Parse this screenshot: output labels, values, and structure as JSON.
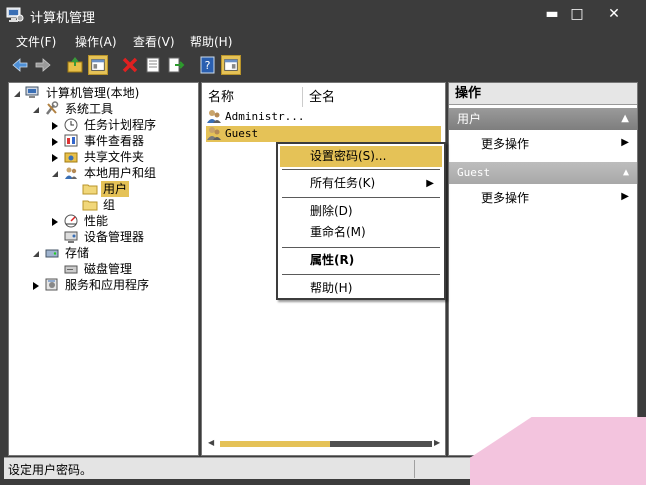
{
  "window": {
    "title": "计算机管理",
    "controls": {
      "minimize": "▬",
      "maximize": "□",
      "close": "✕"
    }
  },
  "menubar": {
    "items": [
      {
        "label": "文件(F)"
      },
      {
        "label": "操作(A)"
      },
      {
        "label": "查看(V)"
      },
      {
        "label": "帮助(H)"
      }
    ]
  },
  "toolbar": {
    "icons": [
      "back-icon",
      "forward-icon",
      "up-folder-icon",
      "show-tree-icon",
      "delete-icon",
      "properties-icon",
      "export-icon",
      "help-icon",
      "action-pane-icon"
    ]
  },
  "tree": {
    "items": [
      {
        "label": "计算机管理(本地)",
        "level": 0,
        "twisty": "open",
        "icon": "computer-icon"
      },
      {
        "label": "系统工具",
        "level": 1,
        "twisty": "open",
        "icon": "tools-icon"
      },
      {
        "label": "任务计划程序",
        "level": 2,
        "twisty": "closed",
        "icon": "clock-icon"
      },
      {
        "label": "事件查看器",
        "level": 2,
        "twisty": "closed",
        "icon": "event-viewer-icon"
      },
      {
        "label": "共享文件夹",
        "level": 2,
        "twisty": "closed",
        "icon": "shared-folder-icon"
      },
      {
        "label": "本地用户和组",
        "level": 2,
        "twisty": "open",
        "icon": "users-icon"
      },
      {
        "label": "用户",
        "level": 3,
        "twisty": "none",
        "icon": "folder-icon",
        "selected": true
      },
      {
        "label": "组",
        "level": 3,
        "twisty": "none",
        "icon": "folder-icon"
      },
      {
        "label": "性能",
        "level": 2,
        "twisty": "closed",
        "icon": "performance-icon"
      },
      {
        "label": "设备管理器",
        "level": 2,
        "twisty": "none",
        "icon": "device-manager-icon"
      },
      {
        "label": "存储",
        "level": 1,
        "twisty": "open",
        "icon": "storage-icon"
      },
      {
        "label": "磁盘管理",
        "level": 2,
        "twisty": "none",
        "icon": "disk-icon"
      },
      {
        "label": "服务和应用程序",
        "level": 1,
        "twisty": "closed",
        "icon": "services-icon"
      }
    ]
  },
  "list": {
    "columns": [
      "名称",
      "全名"
    ],
    "rows": [
      {
        "name": "Administr...",
        "fullname": "",
        "selected": false
      },
      {
        "name": "Guest",
        "fullname": "",
        "selected": true
      }
    ]
  },
  "context_menu": {
    "items": [
      {
        "label": "设置密码(S)...",
        "highlighted": true
      },
      {
        "separator": true
      },
      {
        "label": "所有任务(K)",
        "submenu": true
      },
      {
        "separator": true
      },
      {
        "label": "删除(D)"
      },
      {
        "label": "重命名(M)"
      },
      {
        "separator": true
      },
      {
        "label": "属性(R)",
        "bold": true
      },
      {
        "separator": true
      },
      {
        "label": "帮助(H)"
      }
    ]
  },
  "actions": {
    "header": "操作",
    "sections": [
      {
        "title": "用户",
        "items": [
          "更多操作"
        ]
      },
      {
        "title": "Guest",
        "items": [
          "更多操作"
        ]
      }
    ]
  },
  "statusbar": {
    "text": "设定用户密码。"
  },
  "colors": {
    "accent": "#e5c257",
    "chrome": "#3c3c3c",
    "pane_border": "#777777"
  }
}
